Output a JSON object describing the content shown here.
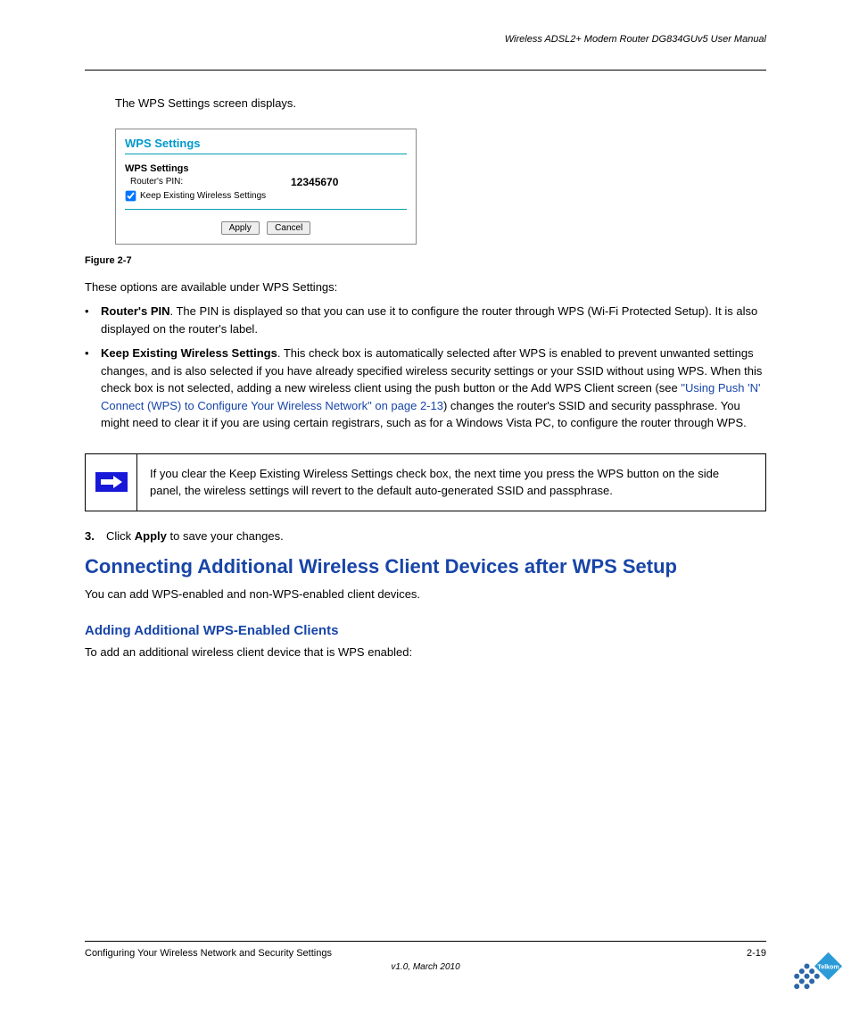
{
  "header": {
    "doc_title": "Wireless ADSL2+ Modem Router DG834GUv5 User Manual"
  },
  "intro_para": "The WPS Settings screen displays.",
  "dialog": {
    "title": "WPS Settings",
    "section_label": "WPS Settings",
    "pin_label": "Router's PIN:",
    "pin_value": "12345670",
    "keep_existing_label": "Keep Existing Wireless Settings",
    "apply_label": "Apply",
    "cancel_label": "Cancel"
  },
  "figure_caption": "Figure 2-7",
  "settings_are": "These options are available under WPS Settings:",
  "bullet1_bold": "Router's PIN",
  "bullet1_text": ". The PIN is displayed so that you can use it to configure the router through WPS (Wi-Fi Protected Setup). It is also displayed on the router's label.",
  "bullet2_bold": "Keep Existing Wireless Settings",
  "bullet2_text": ". This check box is automatically selected after WPS is enabled to prevent unwanted settings changes, and is also selected if you have already specified wireless security settings or your SSID without using WPS. When this check box is not selected, adding a new wireless client using the push button or the Add WPS Client screen (see ",
  "bullet2_link": "\"Using Push 'N' Connect (WPS) to Configure Your Wireless Network\" on page 2-13",
  "bullet2_tail": ") changes the router's SSID and security passphrase. You might need to clear it if you are using certain registrars, such as for a Windows Vista PC, to configure the router through WPS.",
  "note_text": "If you clear the Keep Existing Wireless Settings check box, the next time you press the WPS button on the side panel, the wireless settings will revert to the default auto-generated SSID and passphrase.",
  "step3": "Click ",
  "step3_bold": "Apply",
  "step3_tail": " to save your changes.",
  "h2": "Connecting Additional Wireless Client Devices after WPS Setup",
  "h2_para": "You can add WPS-enabled and non-WPS-enabled client devices.",
  "h3": "Adding Additional WPS-Enabled Clients",
  "h3_para_lead": "To add an additional wireless client device that is WPS enabled:",
  "footer": {
    "left": "Configuring Your Wireless Network and Security Settings",
    "right": "2-19",
    "version": "v1.0, March 2010"
  }
}
